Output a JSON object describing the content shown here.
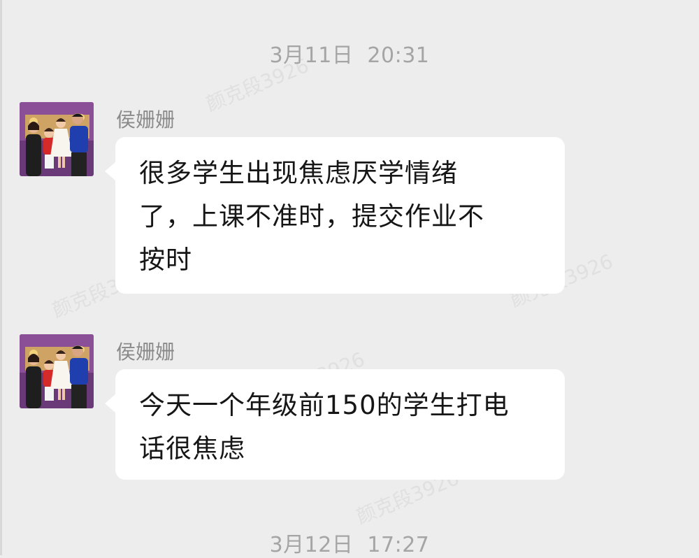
{
  "watermark_text": "颜克段3926",
  "timestamps": [
    "3月11日  20:31",
    "3月12日  17:27"
  ],
  "messages": [
    {
      "sender": "侯姗姗",
      "lines": [
        "很多学生出现焦虑厌学情绪",
        "了，上课不准时，提交作业不",
        "按时"
      ]
    },
    {
      "sender": "侯姗姗",
      "lines": [
        "今天一个年级前150的学生打电",
        "话很焦虑"
      ]
    }
  ],
  "colors": {
    "background": "#ededed",
    "bubble": "#ffffff",
    "timestamp": "#a5a5a5",
    "sender": "#8a8a8a",
    "text": "#161616"
  }
}
